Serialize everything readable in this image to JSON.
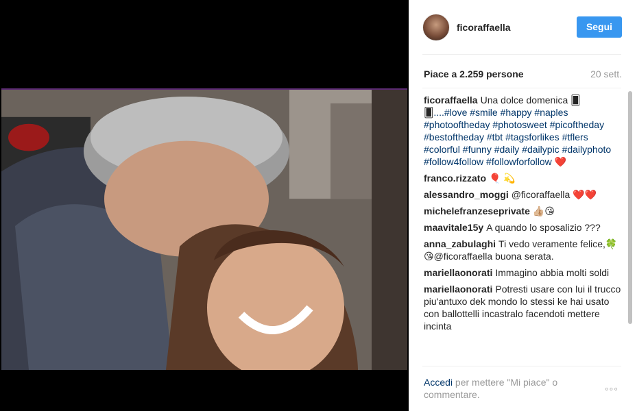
{
  "header": {
    "username": "ficoraffaella",
    "follow_label": "Segui"
  },
  "post": {
    "likes": "Piace a 2.259 persone",
    "time": "20 sett."
  },
  "caption": {
    "author": "ficoraffaella",
    "text_line1": "Una dolce domenica",
    "text_glyphs": "🂠🂠",
    "hashtags": "....#love #smile #happy #naples #photooftheday #photosweet #picoftheday #bestoftheday #tbt #tagsforlikes #tflers #colorful #funny #daily #dailypic #dailyphoto #follow4follow #followforfollow ❤️"
  },
  "comments": [
    {
      "author": "franco.rizzato",
      "text": "🎈 💫"
    },
    {
      "author": "alessandro_moggi",
      "text": "@ficoraffaella ❤️❤️"
    },
    {
      "author": "michelefranzeseprivate",
      "text": "👍🏼😘"
    },
    {
      "author": "maavitale15y",
      "text": "A quando lo sposalizio ???"
    },
    {
      "author": "anna_zabulaghi",
      "text": "Ti vedo veramente felice,🍀😘@ficoraffaella buona serata."
    },
    {
      "author": "mariellaonorati",
      "text": "Immagino abbia molti soldi"
    },
    {
      "author": "mariellaonorati",
      "text": "Potresti usare con lui il trucco piu'antuxo dek mondo lo stessi ke hai usato con ballottelli incastralo facendoti mettere incinta"
    }
  ],
  "footer": {
    "login_link": "Accedi",
    "login_text": " per mettere \"Mi piace\" o commentare.",
    "more_label": "◦◦◦"
  },
  "colors": {
    "accent": "#3897f0",
    "link": "#003569",
    "muted": "#999999"
  }
}
